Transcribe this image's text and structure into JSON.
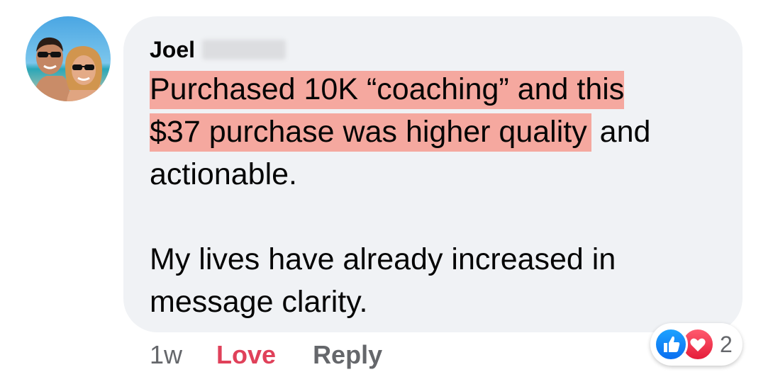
{
  "comment": {
    "author_first_name": "Joel",
    "text": {
      "highlight_line1": "Purchased 10K “coaching” and this",
      "highlight_line2": "$37 purchase was higher quality",
      "after_highlight": " and actionable.",
      "paragraph2": "My lives have already increased in message clarity."
    }
  },
  "actions": {
    "timestamp": "1w",
    "love_label": "Love",
    "reply_label": "Reply"
  },
  "reactions": {
    "icons": [
      "like-icon",
      "heart-icon"
    ],
    "count": "2"
  },
  "colors": {
    "bubble_bg": "#f0f2f5",
    "highlight": "#f5a89f",
    "love_active": "#e0415a",
    "like_blue": "#1877f2",
    "secondary_text": "#65676b"
  }
}
